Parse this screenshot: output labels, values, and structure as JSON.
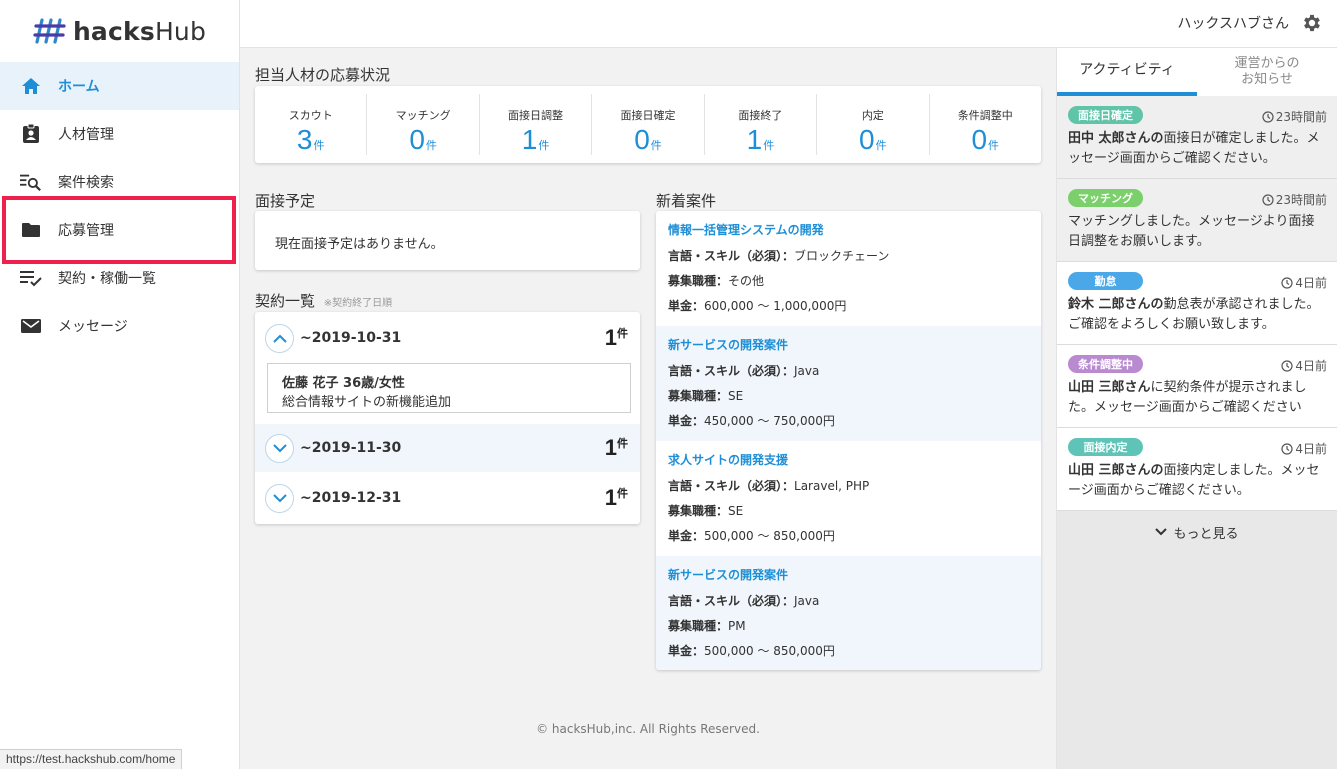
{
  "app": {
    "logo_text_bold": "hacks",
    "logo_text_regular": "Hub"
  },
  "sidebar": {
    "items": [
      {
        "label": "ホーム",
        "icon": "home-icon"
      },
      {
        "label": "人材管理",
        "icon": "id-badge-icon"
      },
      {
        "label": "案件検索",
        "icon": "list-search-icon"
      },
      {
        "label": "応募管理",
        "icon": "folder-icon"
      },
      {
        "label": "契約・稼働一覧",
        "icon": "list-check-icon"
      },
      {
        "label": "メッセージ",
        "icon": "mail-icon"
      }
    ]
  },
  "topbar": {
    "username": "ハックスハブさん"
  },
  "status": {
    "title": "担当人材の応募状況",
    "items": [
      {
        "label": "スカウト",
        "value": "3",
        "unit": "件"
      },
      {
        "label": "マッチング",
        "value": "0",
        "unit": "件"
      },
      {
        "label": "面接日調整",
        "value": "1",
        "unit": "件"
      },
      {
        "label": "面接日確定",
        "value": "0",
        "unit": "件"
      },
      {
        "label": "面接終了",
        "value": "1",
        "unit": "件"
      },
      {
        "label": "内定",
        "value": "0",
        "unit": "件"
      },
      {
        "label": "条件調整中",
        "value": "0",
        "unit": "件"
      }
    ]
  },
  "interviews": {
    "title": "面接予定",
    "empty": "現在面接予定はありません。"
  },
  "contracts": {
    "title": "契約一覧",
    "note": "※契約終了日順",
    "rows": [
      {
        "date": "~2019-10-31",
        "count": "1",
        "unit": "件",
        "name": "佐藤 花子 36歳/女性",
        "desc": "総合情報サイトの新機能追加"
      },
      {
        "date": "~2019-11-30",
        "count": "1",
        "unit": "件"
      },
      {
        "date": "~2019-12-31",
        "count": "1",
        "unit": "件"
      }
    ]
  },
  "jobs": {
    "title": "新着案件",
    "items": [
      {
        "title": "情報一括管理システムの開発",
        "skill_label": "言語・スキル（必須）：",
        "skill": "ブロックチェーン",
        "role_label": "募集職種：",
        "role": "その他",
        "price_label": "単金：",
        "price": "600,000 ～ 1,000,000円"
      },
      {
        "title": "新サービスの開発案件",
        "skill_label": "言語・スキル（必須）：",
        "skill": "Java",
        "role_label": "募集職種：",
        "role": "SE",
        "price_label": "単金：",
        "price": "450,000 ～ 750,000円"
      },
      {
        "title": "求人サイトの開発支援",
        "skill_label": "言語・スキル（必須）：",
        "skill": "Laravel, PHP",
        "role_label": "募集職種：",
        "role": "SE",
        "price_label": "単金：",
        "price": "500,000 ～ 850,000円"
      },
      {
        "title": "新サービスの開発案件",
        "skill_label": "言語・スキル（必須）：",
        "skill": "Java",
        "role_label": "募集職種：",
        "role": "PM",
        "price_label": "単金：",
        "price": "500,000 ～ 850,000円"
      }
    ]
  },
  "activity": {
    "tabs": [
      "アクティビティ",
      "運営からの\nお知らせ"
    ],
    "items": [
      {
        "badge": "面接日確定",
        "color": "#5fc4a8",
        "time": "23時間前",
        "bold": "田中 太郎さんの",
        "text": "面接日が確定しました。メッセージ画面からご確認ください。"
      },
      {
        "badge": "マッチング",
        "color": "#7cd06c",
        "time": "23時間前",
        "bold": "",
        "text": "マッチングしました。メッセージより面接日調整をお願いします。"
      },
      {
        "badge": "勤怠",
        "color": "#4aa8e8",
        "time": "4日前",
        "bold": "鈴木 二郎さんの",
        "text": "勤怠表が承認されました。ご確認をよろしくお願い致します。"
      },
      {
        "badge": "条件調整中",
        "color": "#b98ad0",
        "time": "4日前",
        "bold": "山田 三郎さん",
        "text": "に契約条件が提示されました。メッセージ画面からご確認ください"
      },
      {
        "badge": "面接内定",
        "color": "#5fc4b8",
        "time": "4日前",
        "bold": "山田 三郎さんの",
        "text": "面接内定しました。メッセージ画面からご確認ください。"
      }
    ],
    "more": "もっと見る"
  },
  "footer": "© hacksHub,inc. All Rights Reserved.",
  "browser_status_url": "https://test.hackshub.com/home",
  "colors": {
    "accent": "#1e8fd6",
    "highlight": "#f0204d"
  }
}
